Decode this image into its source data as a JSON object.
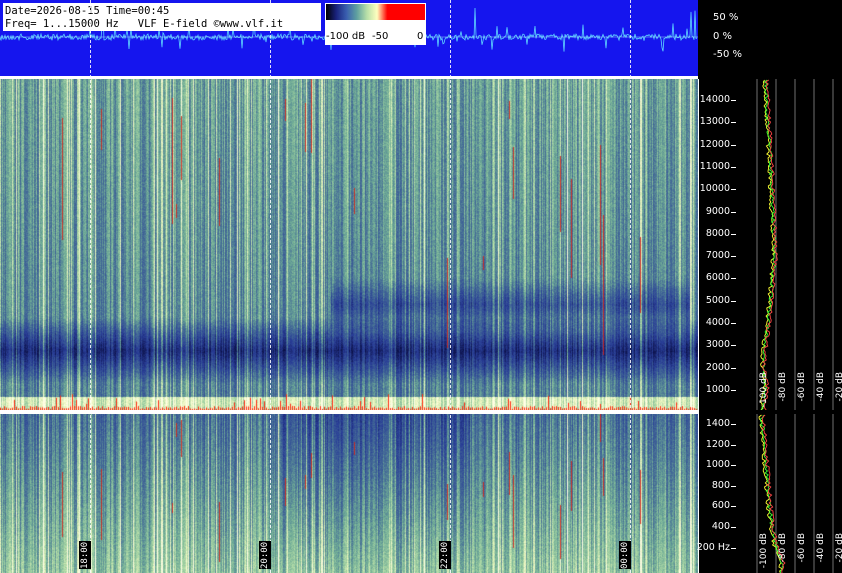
{
  "header": {
    "info_line_1": "Date=2026-08-15 Time=00:45",
    "info_line_2": "Freq= 1...15000 Hz   VLF E-field ©www.vlf.it"
  },
  "color_scale": {
    "labels": [
      "-100 dB",
      "-50",
      "0"
    ],
    "colors": [
      "#000000",
      "#1a237e",
      "#3a5fb0",
      "#5fa0a0",
      "#b8e0a8",
      "#ffffc0",
      "#ff0000"
    ]
  },
  "waveform_axis": {
    "labels": [
      "50 %",
      "0 %",
      "-50 %"
    ]
  },
  "time_axis": {
    "labels": [
      "18:00",
      "20:00",
      "22:00",
      "00:00"
    ]
  },
  "freq_axis_upper": {
    "labels": [
      "14000",
      "13000",
      "12000",
      "11000",
      "10000",
      "9000",
      "8000",
      "7000",
      "6000",
      "5000",
      "4000",
      "3000",
      "2000",
      "1000"
    ]
  },
  "freq_axis_lower": {
    "labels": [
      "1400",
      "1200",
      "1000",
      "800",
      "600",
      "400",
      "200 Hz"
    ]
  },
  "db_axis_upper": {
    "labels": [
      "-100 dB",
      "-80 dB",
      "-60 dB",
      "-40 dB",
      "-20 dB"
    ]
  },
  "db_axis_lower": {
    "labels": [
      "-100 dB",
      "-80 dB",
      "-60 dB",
      "-40 dB",
      "-20 dB"
    ]
  },
  "chart_data": [
    {
      "type": "line",
      "title": "",
      "ylabel": "",
      "yticks": [
        "50 %",
        "0 %",
        "-50 %"
      ],
      "x": [
        "18:00",
        "20:00",
        "22:00",
        "00:00"
      ]
    },
    {
      "type": "heatmap",
      "title": "",
      "x": [
        "18:00",
        "20:00",
        "22:00",
        "00:00"
      ],
      "y_range_hz": [
        1,
        15000
      ],
      "ytick_labels": [
        "1000",
        "2000",
        "3000",
        "4000",
        "5000",
        "6000",
        "7000",
        "8000",
        "9000",
        "10000",
        "11000",
        "12000",
        "13000",
        "14000"
      ],
      "color_scale_db": [
        -100,
        0
      ]
    },
    {
      "type": "heatmap",
      "title": "",
      "x": [
        "18:00",
        "20:00",
        "22:00",
        "00:00"
      ],
      "y_range_hz": [
        0,
        1500
      ],
      "ytick_labels": [
        "200 Hz",
        "400",
        "600",
        "800",
        "1000",
        "1200",
        "1400"
      ],
      "color_scale_db": [
        -100,
        0
      ]
    },
    {
      "type": "line",
      "title": "",
      "xticks": [
        "-100 dB",
        "-80 dB",
        "-60 dB",
        "-40 dB",
        "-20 dB"
      ],
      "xlim": [
        -100,
        -20
      ],
      "series": [
        {
          "y_hz": [
            200,
            1000,
            2000,
            3000,
            5000,
            7000,
            9000,
            11000,
            13000,
            14500
          ],
          "values_db": [
            -95,
            -92,
            -95,
            -93,
            -87,
            -83,
            -85,
            -87,
            -90,
            -92
          ]
        }
      ]
    },
    {
      "type": "line",
      "title": "",
      "xticks": [
        "-100 dB",
        "-80 dB",
        "-60 dB",
        "-40 dB",
        "-20 dB"
      ],
      "xlim": [
        -100,
        -20
      ],
      "series": [
        {
          "y_hz": [
            100,
            200,
            400,
            600,
            800,
            1000,
            1200,
            1400
          ],
          "values_db": [
            -75,
            -80,
            -85,
            -88,
            -90,
            -92,
            -94,
            -96
          ]
        }
      ]
    }
  ]
}
